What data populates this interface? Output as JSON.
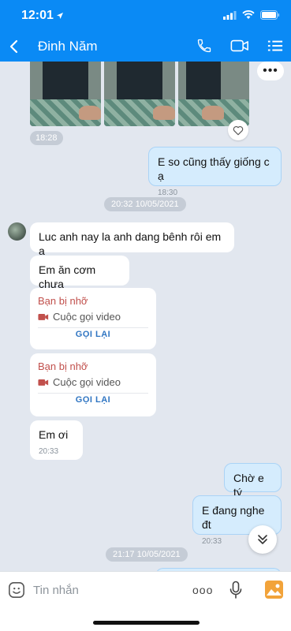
{
  "status_bar": {
    "time": "12:01"
  },
  "header": {
    "contact_name": "Đinh Năm",
    "accent": "#0a8af5"
  },
  "messages": {
    "photo_time": "18:28",
    "out_1": {
      "text": "E so cũng thấy giống c ạ",
      "time": "18:30"
    },
    "date_1": "20:32 10/05/2021",
    "in_1": {
      "text": "Luc anh nay la anh dang bênh  rôi em a"
    },
    "in_2": {
      "text": "Em ăn cơm chưa"
    },
    "missed_1": {
      "title": "Bạn bị nhỡ",
      "call_type": "Cuộc gọi video",
      "callback": "GỌI LẠI"
    },
    "missed_2": {
      "title": "Bạn bị nhỡ",
      "call_type": "Cuộc gọi video",
      "callback": "GỌI LẠI"
    },
    "in_3": {
      "text": "Em ơi",
      "time": "20:33"
    },
    "out_2": {
      "text": "Chờ e tý"
    },
    "out_3": {
      "text": "E đang nghe đt",
      "time": "20:33"
    },
    "date_2": "21:17 10/05/2021"
  },
  "input": {
    "placeholder": "Tin nhắn"
  },
  "icons": {
    "back": "chevron-left-icon",
    "call": "phone-icon",
    "video": "video-camera-icon",
    "menu": "list-menu-icon",
    "emoji": "emoji-icon",
    "more": "more-dots-icon",
    "mic": "microphone-icon",
    "image": "image-icon",
    "heart": "heart-icon",
    "scroll": "double-chevron-down-icon"
  }
}
